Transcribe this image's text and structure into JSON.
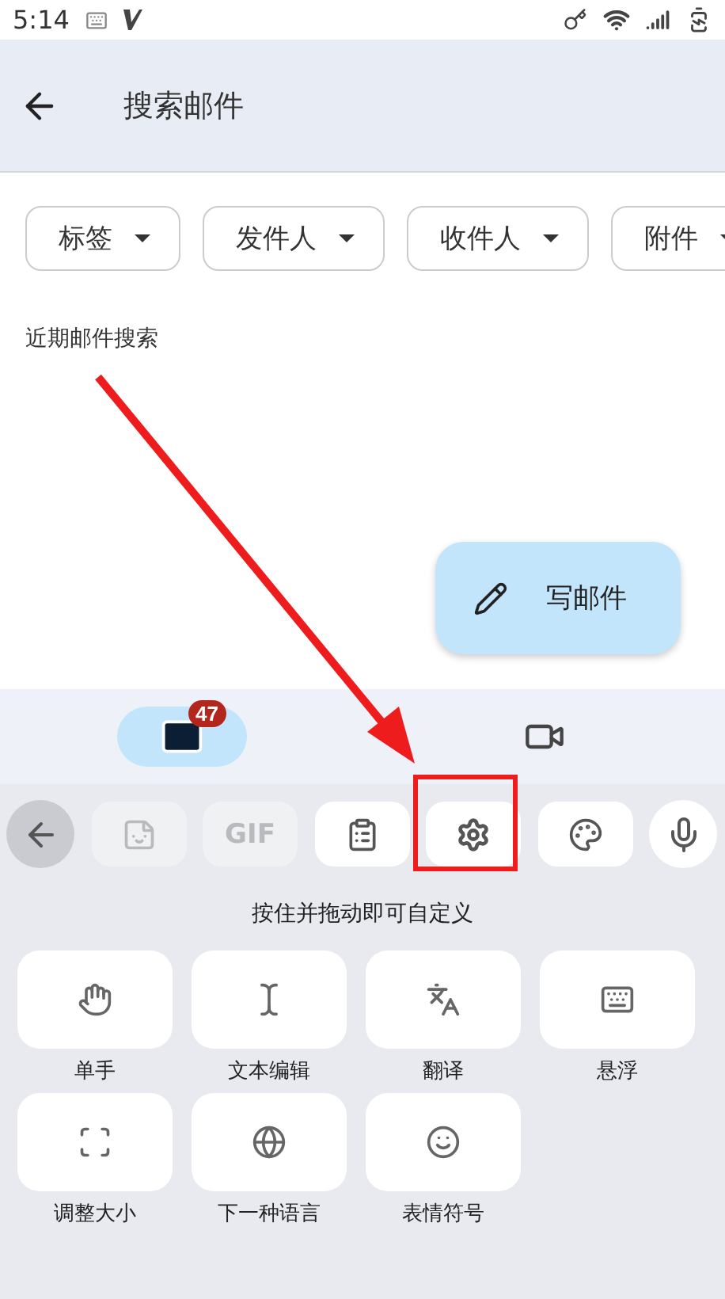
{
  "status_bar": {
    "time": "5:14"
  },
  "app_bar": {
    "title": "搜索邮件"
  },
  "filters": [
    {
      "label": "标签"
    },
    {
      "label": "发件人"
    },
    {
      "label": "收件人"
    },
    {
      "label": "附件"
    }
  ],
  "recent_label": "近期邮件搜索",
  "fab": {
    "label": "写邮件"
  },
  "nav": [
    {
      "kind": "mail",
      "selected": true,
      "badge": "47"
    },
    {
      "kind": "video",
      "selected": false
    }
  ],
  "keyboard_toolbar": [
    {
      "kind": "back",
      "disabled": false
    },
    {
      "kind": "sticker",
      "disabled": true
    },
    {
      "kind": "gif",
      "label": "GIF",
      "disabled": true
    },
    {
      "kind": "clipboard",
      "disabled": false
    },
    {
      "kind": "settings",
      "disabled": false,
      "highlighted": true
    },
    {
      "kind": "theme",
      "disabled": false
    },
    {
      "kind": "mic",
      "disabled": false
    }
  ],
  "hint": "按住并拖动即可自定义",
  "tiles": [
    {
      "kind": "one_hand",
      "label": "单手"
    },
    {
      "kind": "text_edit",
      "label": "文本编辑"
    },
    {
      "kind": "translate",
      "label": "翻译"
    },
    {
      "kind": "floating",
      "label": "悬浮"
    },
    {
      "kind": "resize",
      "label": "调整大小"
    },
    {
      "kind": "language",
      "label": "下一种语言"
    },
    {
      "kind": "emoji",
      "label": "表情符号"
    }
  ]
}
